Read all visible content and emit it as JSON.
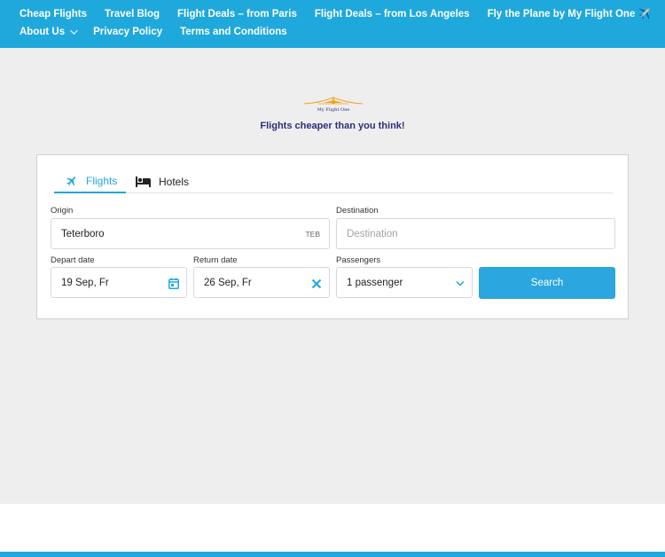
{
  "nav": {
    "row1": [
      "Cheap Flights",
      "Travel Blog",
      "Flight Deals – from Paris",
      "Flight Deals – from Los Angeles",
      "Fly the Plane by My Flight One"
    ],
    "row1_icon": "airplane-emoji",
    "row2": {
      "about": "About Us",
      "privacy": "Privacy Policy",
      "terms": "Terms and Conditions"
    }
  },
  "brand": {
    "logo_text": "My Flight One",
    "tagline": "Flights cheaper than you think!"
  },
  "tabs": {
    "flights": "Flights",
    "hotels": "Hotels"
  },
  "form": {
    "origin_label": "Origin",
    "origin_value": "Teterboro",
    "origin_code": "TEB",
    "destination_label": "Destination",
    "destination_placeholder": "Destination",
    "depart_label": "Depart date",
    "depart_value": "19 Sep, Fr",
    "return_label": "Return date",
    "return_value": "26 Sep, Fr",
    "passengers_label": "Passengers",
    "passengers_value": "1 passenger",
    "search_label": "Search"
  },
  "colors": {
    "accent": "#1fa8dc",
    "tagline": "#2b2f7a",
    "logo": "#f0a51c"
  }
}
